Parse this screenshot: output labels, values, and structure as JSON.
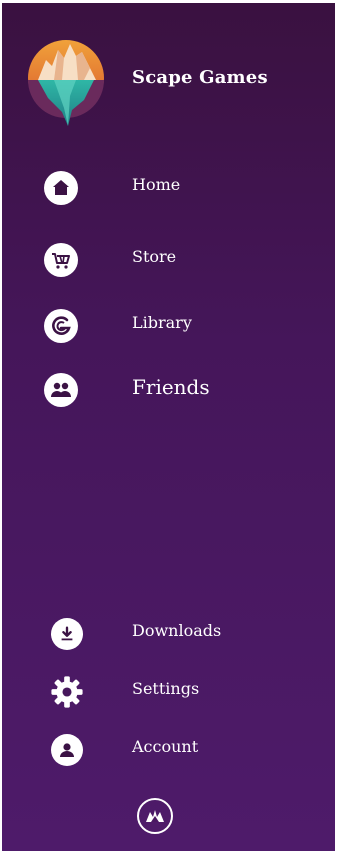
{
  "app": {
    "name": "Scape Games"
  },
  "nav": {
    "home": "Home",
    "store": "Store",
    "library": "Library",
    "friends": "Friends"
  },
  "bottom_nav": {
    "downloads": "Downloads",
    "settings": "Settings",
    "account": "Account"
  },
  "colors": {
    "panel_top": "#3a1140",
    "panel_bottom": "#4e1b6a",
    "icon_fg": "#3b1244",
    "text": "#ffffff"
  },
  "icons": [
    "home-icon",
    "cart-icon",
    "library-icon",
    "friends-icon",
    "download-icon",
    "gear-icon",
    "account-icon",
    "brand-mark-icon"
  ]
}
